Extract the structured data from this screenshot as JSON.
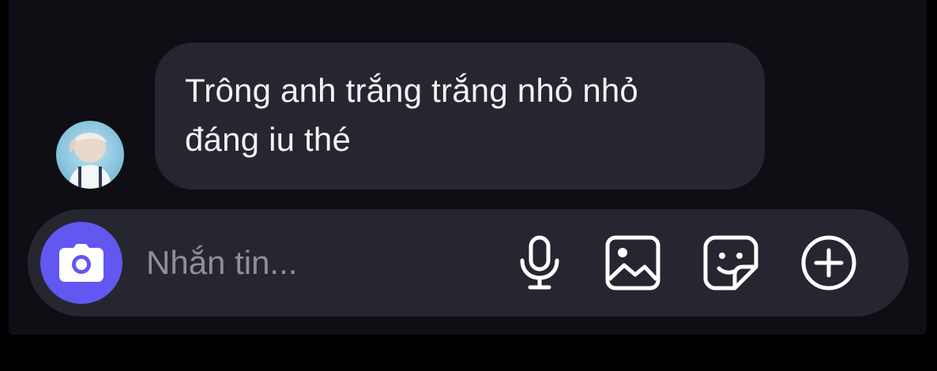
{
  "message": {
    "text": "Trông anh trắng trắng nhỏ nhỏ\nđáng iu thé"
  },
  "composer": {
    "placeholder": "Nhắn tin..."
  },
  "icons": {
    "camera": "camera-icon",
    "microphone": "microphone-icon",
    "gallery": "image-gallery-icon",
    "sticker": "sticker-icon",
    "add": "plus-circle-icon"
  },
  "colors": {
    "background": "#0e0e14",
    "bubble": "#262630",
    "accent": "#6257f0",
    "text": "#f2f2f4",
    "placeholder": "#8f9096"
  }
}
